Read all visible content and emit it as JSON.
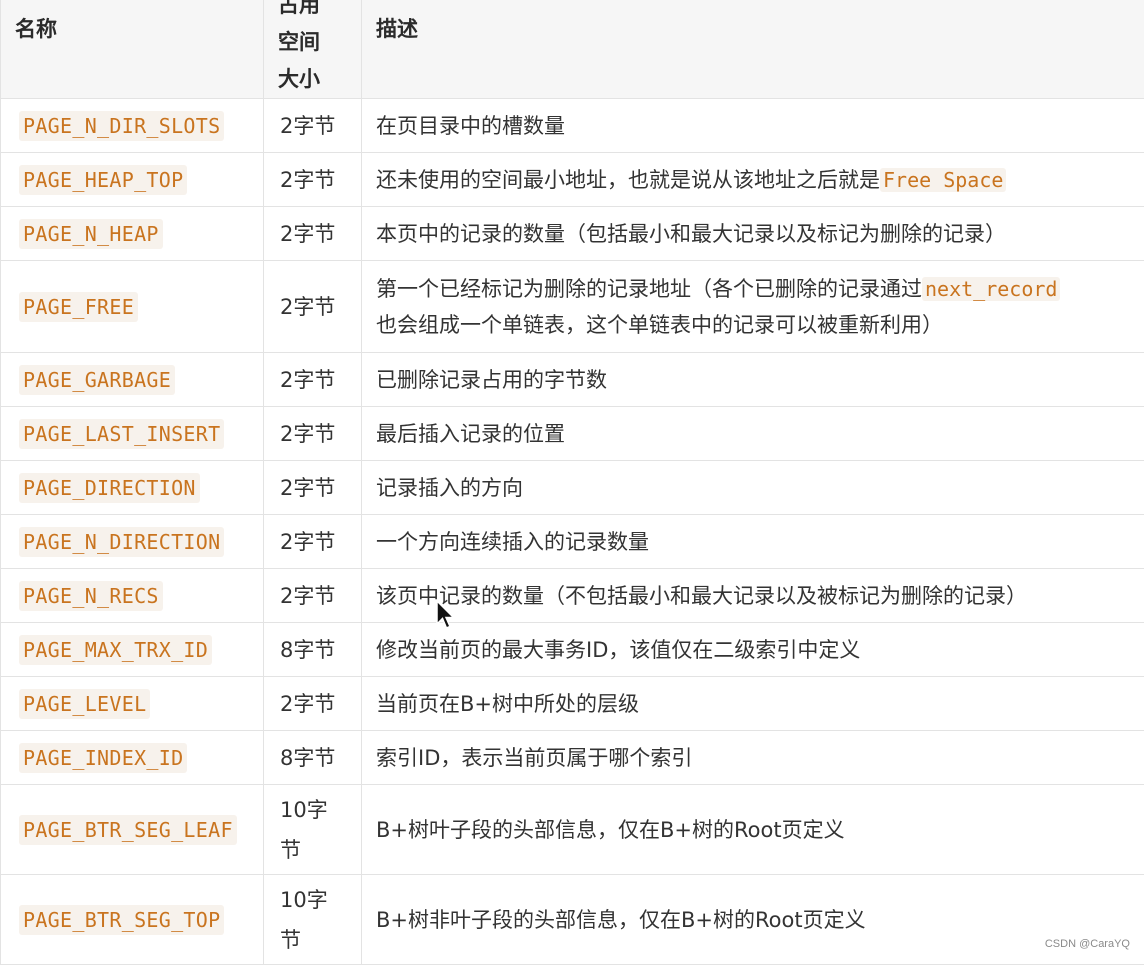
{
  "table": {
    "headers": {
      "name": "名称",
      "size_line1": "占用",
      "size_line2": "空间",
      "size_line3": "大小",
      "desc": "描述"
    },
    "rows": [
      {
        "name": "PAGE_N_DIR_SLOTS",
        "size": "2字节",
        "desc": "在页目录中的槽数量"
      },
      {
        "name": "PAGE_HEAP_TOP",
        "size": "2字节",
        "desc_pre": "还未使用的空间最小地址，也就是说从该地址之后就是",
        "desc_code": "Free Space"
      },
      {
        "name": "PAGE_N_HEAP",
        "size": "2字节",
        "desc": "本页中的记录的数量（包括最小和最大记录以及标记为删除的记录）"
      },
      {
        "name": "PAGE_FREE",
        "size": "2字节",
        "desc_pre": "第一个已经标记为删除的记录地址（各个已删除的记录通过",
        "desc_code": "next_record",
        "desc_post": "也会组成一个单链表，这个单链表中的记录可以被重新利用）"
      },
      {
        "name": "PAGE_GARBAGE",
        "size": "2字节",
        "desc": "已删除记录占用的字节数"
      },
      {
        "name": "PAGE_LAST_INSERT",
        "size": "2字节",
        "desc": "最后插入记录的位置"
      },
      {
        "name": "PAGE_DIRECTION",
        "size": "2字节",
        "desc": "记录插入的方向"
      },
      {
        "name": "PAGE_N_DIRECTION",
        "size": "2字节",
        "desc": "一个方向连续插入的记录数量"
      },
      {
        "name": "PAGE_N_RECS",
        "size": "2字节",
        "desc": "该页中记录的数量（不包括最小和最大记录以及被标记为删除的记录）"
      },
      {
        "name": "PAGE_MAX_TRX_ID",
        "size": "8字节",
        "desc": "修改当前页的最大事务ID，该值仅在二级索引中定义"
      },
      {
        "name": "PAGE_LEVEL",
        "size": "2字节",
        "desc": "当前页在B+树中所处的层级"
      },
      {
        "name": "PAGE_INDEX_ID",
        "size": "8字节",
        "desc": "索引ID，表示当前页属于哪个索引"
      },
      {
        "name": "PAGE_BTR_SEG_LEAF",
        "size_line1": "10字",
        "size_line2": "节",
        "desc": "B+树叶子段的头部信息，仅在B+树的Root页定义"
      },
      {
        "name": "PAGE_BTR_SEG_TOP",
        "size_line1": "10字",
        "size_line2": "节",
        "desc": "B+树非叶子段的头部信息，仅在B+树的Root页定义"
      }
    ]
  },
  "watermark": "CSDN @CaraYQ",
  "cursor_icon": "arrow-cursor-icon",
  "colors": {
    "code_text": "#c9741f",
    "code_bg": "#f7f2ec",
    "header_bg": "#f6f6f6",
    "border": "#e3e3e3"
  }
}
